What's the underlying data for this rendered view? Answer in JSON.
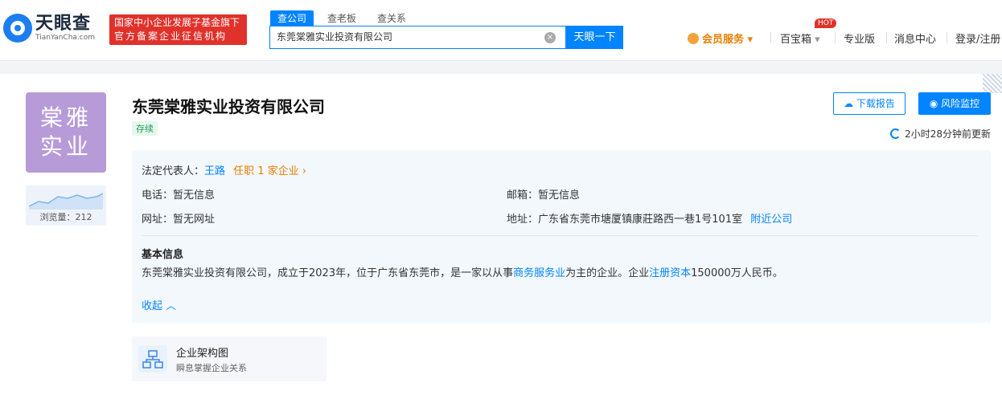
{
  "header": {
    "logo_cn": "天眼查",
    "logo_en": "TianYanCha.com",
    "badge_line1": "国家中小企业发展子基金旗下",
    "badge_line2": "官方备案企业征信机构",
    "tabs": [
      "查公司",
      "查老板",
      "查关系"
    ],
    "search_value": "东莞棠雅实业投资有限公司",
    "search_button": "天眼一下",
    "nav": {
      "vip": "会员服务",
      "treasure": "百宝箱",
      "hot": "HOT",
      "pro": "专业版",
      "messages": "消息中心",
      "login": "登录/注册"
    }
  },
  "company": {
    "avatar_line1": "棠雅",
    "avatar_line2": "实业",
    "views_label": "浏览量：212",
    "name": "东莞棠雅实业投资有限公司",
    "status": "存续",
    "download_report": "下载报告",
    "risk_monitor": "风险监控",
    "updated": "2小时28分钟前更新"
  },
  "info": {
    "legal_rep_label": "法定代表人：",
    "legal_rep_name": "王路",
    "legal_rep_roles": "任职 1 家企业",
    "phone_label": "电话：",
    "phone_value": "暂无信息",
    "email_label": "邮箱：",
    "email_value": "暂无信息",
    "website_label": "网址：",
    "website_value": "暂无网址",
    "address_label": "地址：",
    "address_value": "广东省东莞市塘厦镇康莊路西一巷1号101室",
    "nearby": "附近公司",
    "basic_title": "基本信息",
    "basic_text_1": "东莞棠雅实业投资有限公司，成立于2023年，位于广东省东莞市，是一家以从事",
    "basic_link_1": "商务服务业",
    "basic_text_2": "为主的企业。企业",
    "basic_link_2": "注册资本",
    "basic_text_3": "150000万人民币。",
    "collapse": "收起"
  },
  "structure": {
    "title": "企业架构图",
    "subtitle": "瞬息掌握企业关系"
  }
}
